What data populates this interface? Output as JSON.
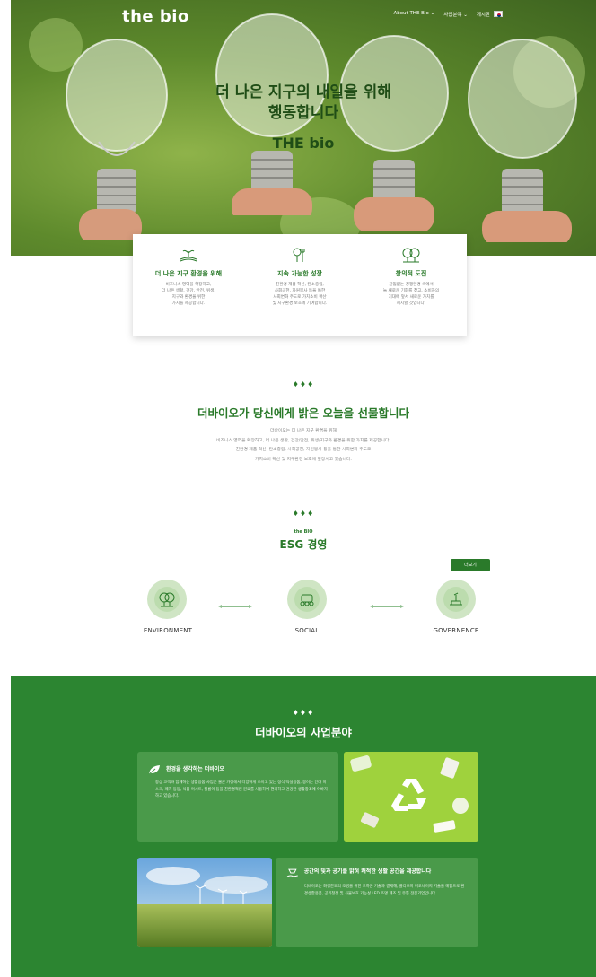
{
  "header": {
    "logo": "the bio",
    "nav": [
      "About THE Bio ⌄",
      "사업분야 ⌄",
      "게시판"
    ]
  },
  "hero": {
    "line1": "더 나은 지구의 내일을 위해",
    "line2": "행동합니다",
    "line3": "THE bio"
  },
  "features": [
    {
      "icon": "seedling-field-icon",
      "title": "더 나은 지구 환경을 위해",
      "desc": [
        "비즈니스 영역을 확장하고,",
        "더 나은 생활, 건강, 안전, 위생,",
        "지구와 환경을 위한",
        "가치를 제공합니다."
      ]
    },
    {
      "icon": "tree-fork-icon",
      "title": "지속 가능한 성장",
      "desc": [
        "친환경 제품 혁신, 탄소중립,",
        "사회공헌, 자원봉사 등을 통한",
        "사회변화 주도로 가치소비 확산",
        "및 지구환경 보호에 기여합니다."
      ]
    },
    {
      "icon": "trees-icon",
      "title": "창의적 도전",
      "desc": [
        "끊임없는 경쟁환경 속에서",
        "늘 새로운 기회를 찾고, 소비자의",
        "기대에 앞서 새로운 가치를",
        "제시할 것입니다."
      ]
    }
  ],
  "intro": {
    "dots": "♦♦♦",
    "title": "더바이오가 당신에게 밝은 오늘을 선물합니다",
    "body": [
      "더바이오는 더 나은 지구 환경을 위해",
      "비즈니스 영역을 확장하고, 더 나은 생활, 건강/안전, 위생/지구와 환경을 위한 가치를 제공합니다.",
      "친환경 제품 혁신, 탄소중립, 사회공헌, 자원봉사 등을 통한 사회변화 주도로",
      "가치소비 확산 및 지구환경 보호에 앞장서고 있습니다."
    ]
  },
  "esg": {
    "dots": "♦♦♦",
    "kicker": "the BIO",
    "title": "ESG 경영",
    "more": "더보기",
    "items": [
      {
        "label": "ENVIRONMENT",
        "icon": "environment-icon"
      },
      {
        "label": "SOCIAL",
        "icon": "social-icon"
      },
      {
        "label": "GOVERNENCE",
        "icon": "governance-icon"
      }
    ]
  },
  "business": {
    "dots": "♦♦♦",
    "title": "더바이오의 사업분야",
    "cards": [
      {
        "icon": "leaf-icon",
        "title": "환경을 생각하는 더바이오",
        "body": "항상 고객과 함께하는 생활용품 사업은 물론 가정에서 다양하게 쓰이고 있는 정식/욕실용품, 봉이는 안대 마스크, 패치 등등, 식품 어시트, 필름이 등을 친환경적인 원료를 사용하여 편리하고 건강한 생활창조에 이바지하고 있습니다."
      },
      {
        "icon": "lamp-hand-icon",
        "title": "공간의 빛과 공기를 밝혀 쾌적한 생활 공간을 제공합니다",
        "body": "더바이오는 화경한도의 조명을 위한 오하온 기술과 결제해, 플라즈마 미오나이저 기술을 매합으로 환경생활용품, 공기청정 및 사물보호 기능성 LED 조명 제조 및 유통 전문기업입니다."
      }
    ]
  },
  "colors": {
    "brand_green": "#2a7a2a",
    "section_green": "#2c8531",
    "card_green": "#4a9a4a"
  }
}
